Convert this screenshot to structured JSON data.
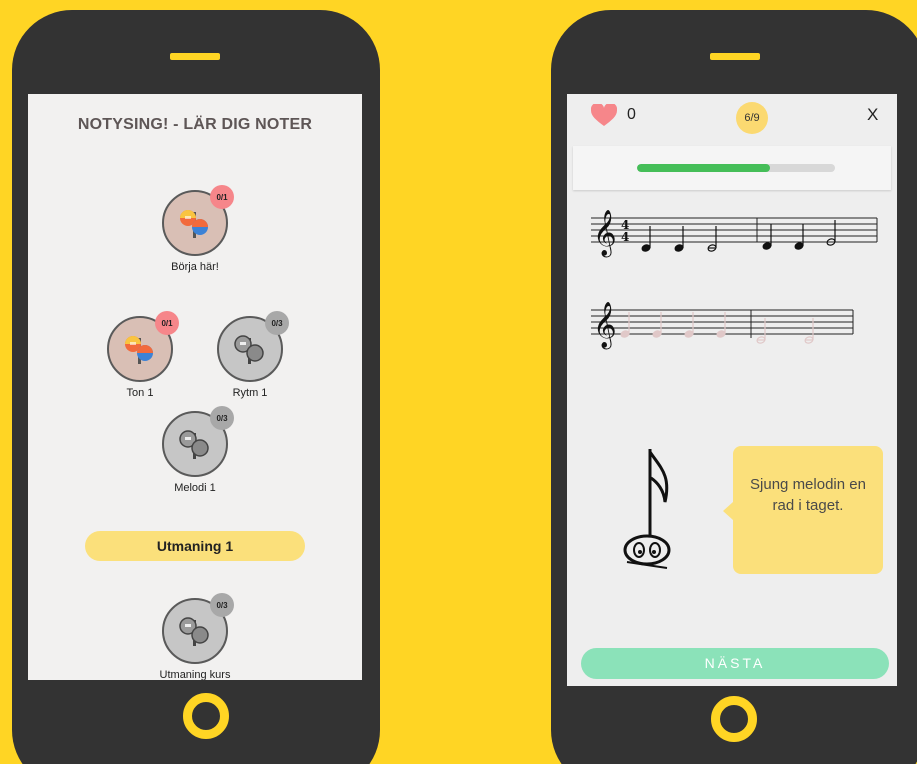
{
  "left": {
    "app_title": "NOTYSING! - LÄR DIG NOTER",
    "lessons": [
      {
        "label": "Börja här!",
        "badge": "0/1",
        "state": "active"
      },
      {
        "label": "Ton 1",
        "badge": "0/1",
        "state": "active"
      },
      {
        "label": "Rytm 1",
        "badge": "0/3",
        "state": "locked"
      },
      {
        "label": "Melodi 1",
        "badge": "0/3",
        "state": "locked"
      },
      {
        "label": "Utmaning kurs",
        "badge": "0/3",
        "state": "locked"
      }
    ],
    "challenge_label": "Utmaning 1"
  },
  "right": {
    "lives": "0",
    "step": "6/9",
    "close_label": "X",
    "progress": 0.67,
    "time_signature": {
      "top": "4",
      "bottom": "4"
    },
    "speech_bubble": "Sjung melodin en rad i taget.",
    "next_label": "NÄSTA"
  },
  "colors": {
    "background": "#FFD524",
    "phone_body": "#333333",
    "badge_red": "#F6868A",
    "badge_grey": "#A8A8A8",
    "challenge": "#FBE07B",
    "progress": "#45BE58",
    "next_button": "#8BE2B9",
    "heart": "#F6868A"
  },
  "icons": [
    "maracas-icon",
    "heart-icon",
    "treble-clef-icon",
    "close-icon",
    "note-character-icon"
  ]
}
